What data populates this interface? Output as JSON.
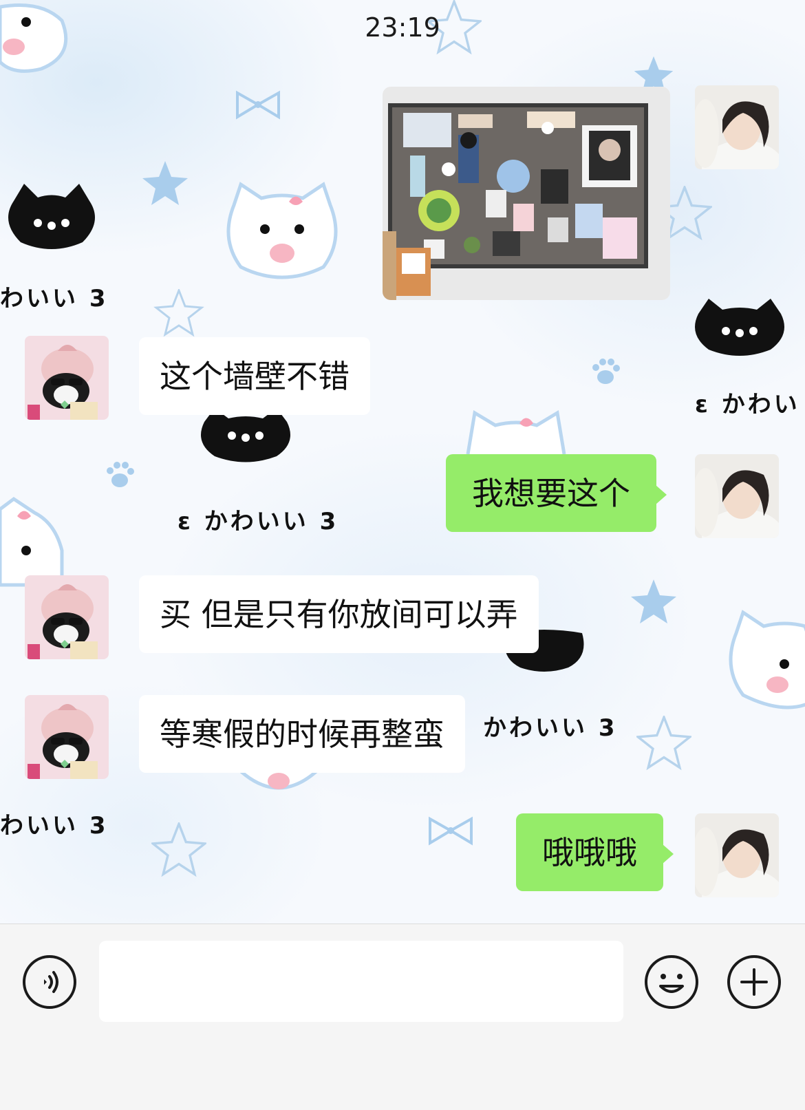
{
  "status": {
    "time": "23:19"
  },
  "background": {
    "sticker_text_1": "わいい 3",
    "sticker_text_2": "ɛ かわいい 3",
    "sticker_text_3": "ɛ かわいい 3",
    "sticker_text_4": "かわいい 3",
    "sticker_text_5": "わいい 3",
    "sticker_text_6": "ɛ かわい"
  },
  "messages": [
    {
      "side": "right",
      "type": "image",
      "alt_icon": "photo-board-image"
    },
    {
      "side": "left",
      "type": "text",
      "text": "这个墙壁不错"
    },
    {
      "side": "right",
      "type": "text",
      "text": "我想要这个"
    },
    {
      "side": "left",
      "type": "text",
      "text": "买  但是只有你放间可以弄"
    },
    {
      "side": "left",
      "type": "text",
      "text": "等寒假的时候再整蛮"
    },
    {
      "side": "right",
      "type": "text",
      "text": "哦哦哦"
    }
  ],
  "input_bar": {
    "placeholder": "",
    "voice_icon": "voice-icon",
    "emoji_icon": "emoji-icon",
    "plus_icon": "plus-icon"
  },
  "colors": {
    "outgoing_bubble": "#95ec69",
    "incoming_bubble": "#ffffff",
    "input_bar_bg": "#f5f5f5"
  }
}
